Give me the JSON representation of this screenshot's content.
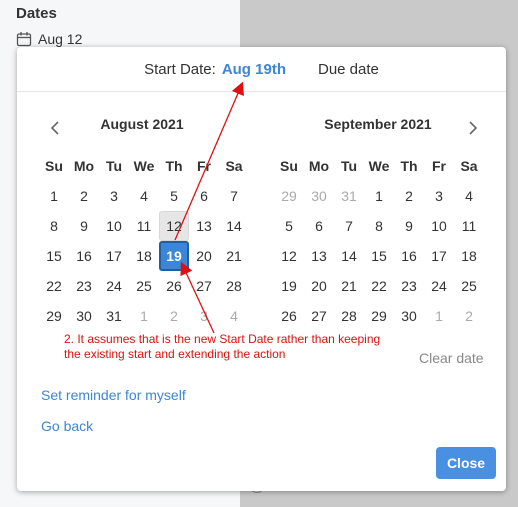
{
  "background": {
    "section_title": "Dates",
    "section_date": "Aug 12",
    "calendar_icon": "calendar-icon"
  },
  "popup": {
    "start_label": "Start Date:",
    "start_value": "Aug 19th",
    "due_label": "Due date",
    "prev_icon": "chevron-left-icon",
    "next_icon": "chevron-right-icon",
    "weekdays": [
      "Su",
      "Mo",
      "Tu",
      "We",
      "Th",
      "Fr",
      "Sa"
    ],
    "months": [
      {
        "title": "August 2021",
        "weeks": [
          [
            {
              "d": "1"
            },
            {
              "d": "2"
            },
            {
              "d": "3"
            },
            {
              "d": "4"
            },
            {
              "d": "5"
            },
            {
              "d": "6"
            },
            {
              "d": "7"
            }
          ],
          [
            {
              "d": "8"
            },
            {
              "d": "9"
            },
            {
              "d": "10"
            },
            {
              "d": "11"
            },
            {
              "d": "12",
              "state": "hover"
            },
            {
              "d": "13"
            },
            {
              "d": "14"
            }
          ],
          [
            {
              "d": "15"
            },
            {
              "d": "16"
            },
            {
              "d": "17"
            },
            {
              "d": "18"
            },
            {
              "d": "19",
              "state": "selected"
            },
            {
              "d": "20"
            },
            {
              "d": "21"
            }
          ],
          [
            {
              "d": "22"
            },
            {
              "d": "23"
            },
            {
              "d": "24"
            },
            {
              "d": "25"
            },
            {
              "d": "26"
            },
            {
              "d": "27"
            },
            {
              "d": "28"
            }
          ],
          [
            {
              "d": "29"
            },
            {
              "d": "30"
            },
            {
              "d": "31"
            },
            {
              "d": "1",
              "state": "out"
            },
            {
              "d": "2",
              "state": "out"
            },
            {
              "d": "3",
              "state": "out"
            },
            {
              "d": "4",
              "state": "out"
            }
          ]
        ]
      },
      {
        "title": "September 2021",
        "weeks": [
          [
            {
              "d": "29",
              "state": "out"
            },
            {
              "d": "30",
              "state": "out"
            },
            {
              "d": "31",
              "state": "out"
            },
            {
              "d": "1"
            },
            {
              "d": "2"
            },
            {
              "d": "3"
            },
            {
              "d": "4"
            }
          ],
          [
            {
              "d": "5"
            },
            {
              "d": "6"
            },
            {
              "d": "7"
            },
            {
              "d": "8"
            },
            {
              "d": "9"
            },
            {
              "d": "10"
            },
            {
              "d": "11"
            }
          ],
          [
            {
              "d": "12"
            },
            {
              "d": "13"
            },
            {
              "d": "14"
            },
            {
              "d": "15"
            },
            {
              "d": "16"
            },
            {
              "d": "17"
            },
            {
              "d": "18"
            }
          ],
          [
            {
              "d": "19"
            },
            {
              "d": "20"
            },
            {
              "d": "21"
            },
            {
              "d": "22"
            },
            {
              "d": "23"
            },
            {
              "d": "24"
            },
            {
              "d": "25"
            }
          ],
          [
            {
              "d": "26"
            },
            {
              "d": "27"
            },
            {
              "d": "28"
            },
            {
              "d": "29"
            },
            {
              "d": "30"
            },
            {
              "d": "1",
              "state": "out"
            },
            {
              "d": "2",
              "state": "out"
            }
          ]
        ]
      }
    ],
    "clear_label": "Clear date",
    "reminder_label": "Set reminder for myself",
    "go_back_label": "Go back",
    "close_label": "Close"
  },
  "annotation": {
    "text": "2. It assumes that is the new Start Date rather than keeping the existing start and extending the action",
    "color": "#dd1111"
  },
  "colors": {
    "accent": "#3b86d6",
    "button": "#4a90e2"
  }
}
